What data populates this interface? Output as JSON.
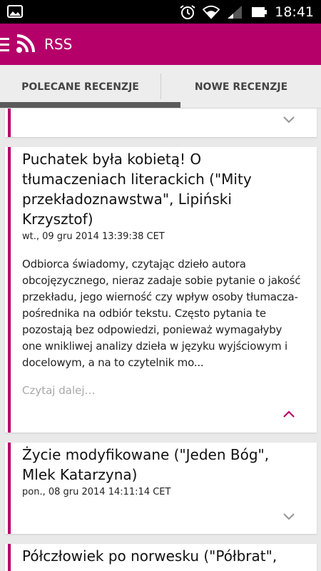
{
  "status_bar": {
    "time": "18:41",
    "icons": [
      "gallery-icon",
      "alarm-icon",
      "wifi-icon",
      "signal-icon",
      "battery-icon"
    ]
  },
  "app_bar": {
    "title": "RSS",
    "icons": [
      "menu-icon",
      "rss-icon"
    ],
    "color": "#b5006a"
  },
  "tabs": [
    {
      "label": "POLECANE RECENZJE",
      "selected": true
    },
    {
      "label": "NOWE RECENZJE",
      "selected": false
    }
  ],
  "cards": [
    {
      "title": "",
      "date": "",
      "expanded": false
    },
    {
      "title": "Puchatek była kobietą! O tłumaczeniach literackich (\"Mity przekładoznawstwa\", Lipiński Krzysztof)",
      "date": "wt., 09 gru 2014 13:39:38 CET",
      "body": "Odbiorca świadomy, czytając dzieło autora obcojęzycznego, nieraz zadaje sobie pytanie o jakość przekładu, jego wierność czy wpływ osoby tłumacza-pośrednika na odbiór tekstu. Często pytania te pozostają bez odpowiedzi, ponieważ wymagałyby one wnikliwej analizy dzieła w języku wyjściowym i docelowym, a na to czytelnik mo...",
      "read_more": "Czytaj dalej…",
      "expanded": true
    },
    {
      "title": "Życie modyfikowane (\"Jeden Bóg\", Mlek Katarzyna)",
      "date": "pon., 08 gru 2014 14:11:14 CET",
      "expanded": false
    },
    {
      "title": "Półczłowiek po norwesku (\"Półbrat\",",
      "expanded": false
    }
  ],
  "colors": {
    "accent": "#b5006a",
    "chevron_collapsed": "#9a9a9a"
  }
}
